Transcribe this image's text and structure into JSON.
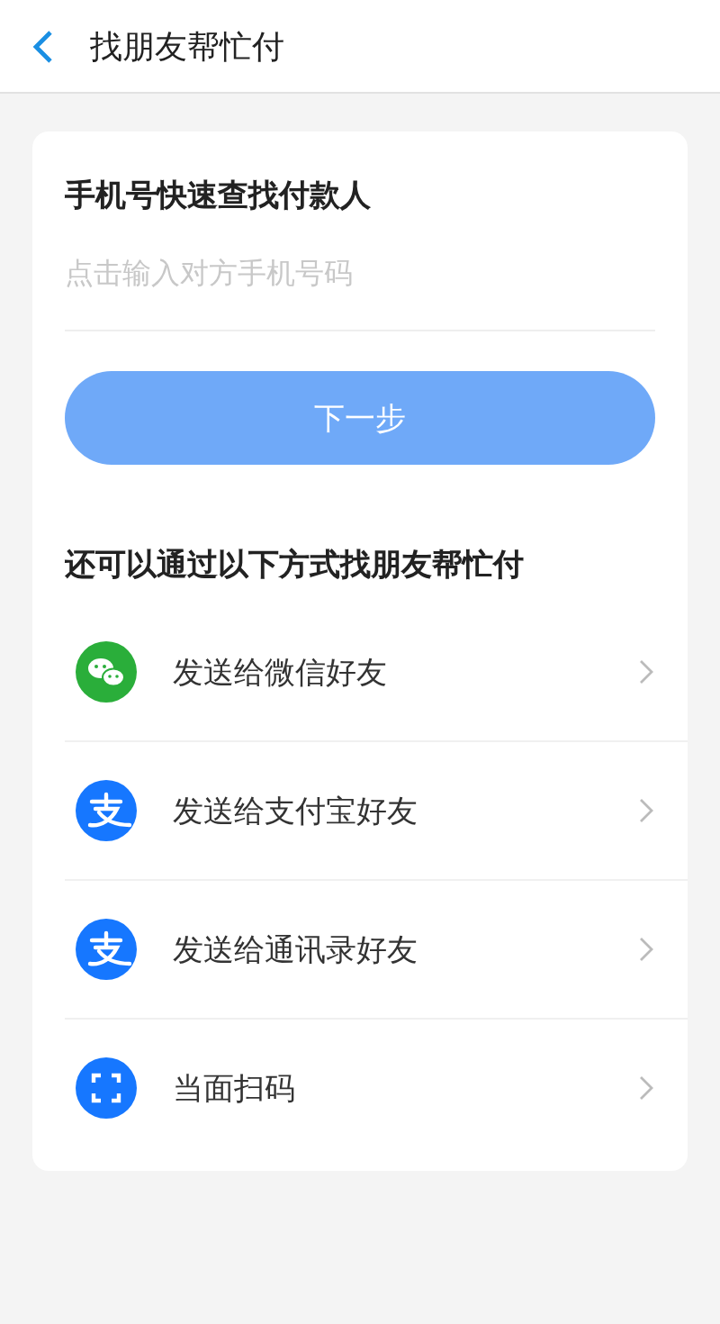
{
  "header": {
    "title": "找朋友帮忙付"
  },
  "phone_search": {
    "heading": "手机号快速查找付款人",
    "placeholder": "点击输入对方手机号码",
    "button": "下一步",
    "disabled": true
  },
  "other_ways": {
    "heading": "还可以通过以下方式找朋友帮忙付",
    "items": [
      {
        "label": "发送给微信好友",
        "kind": "chat"
      },
      {
        "label": "发送给支付宝好友",
        "kind": "pay"
      },
      {
        "label": "发送给通讯录好友",
        "kind": "pay"
      },
      {
        "label": "当面扫码",
        "kind": "scan"
      }
    ]
  }
}
